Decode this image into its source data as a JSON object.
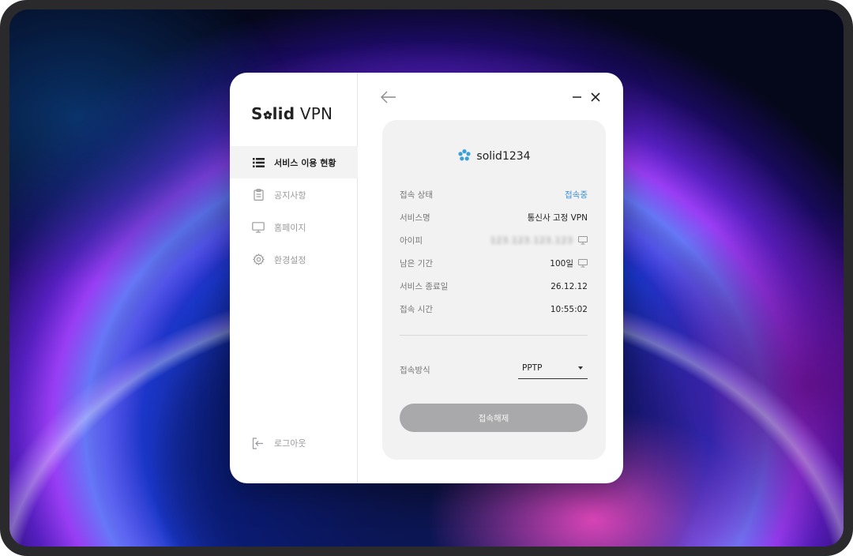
{
  "app": {
    "logo_brand": "Solid",
    "logo_product": "VPN"
  },
  "sidebar": {
    "items": [
      {
        "label": "서비스 이용 현황",
        "icon": "list-icon",
        "active": true
      },
      {
        "label": "공지사항",
        "icon": "clipboard-icon",
        "active": false
      },
      {
        "label": "홈페이지",
        "icon": "monitor-icon",
        "active": false
      },
      {
        "label": "환경설정",
        "icon": "gear-icon",
        "active": false
      }
    ],
    "logout_label": "로그아웃"
  },
  "user": {
    "name": "solid1234"
  },
  "status": {
    "rows": [
      {
        "key": "접속 상태",
        "value": "접속중"
      },
      {
        "key": "서비스명",
        "value": "통신사 고정 VPN"
      },
      {
        "key": "아이피",
        "value": "123.123.123.123"
      },
      {
        "key": "남은 기간",
        "value": "100일"
      },
      {
        "key": "서비스 종료일",
        "value": "26.12.12"
      },
      {
        "key": "접속 시간",
        "value": "10:55:02"
      }
    ]
  },
  "connection": {
    "method_label": "접속방식",
    "method_value": "PPTP",
    "disconnect_label": "접속해제"
  },
  "colors": {
    "accent": "#3a8ed8",
    "window_bg": "#ffffff",
    "card_bg": "#f2f2f3",
    "button_disabled": "#a9a9ab"
  }
}
